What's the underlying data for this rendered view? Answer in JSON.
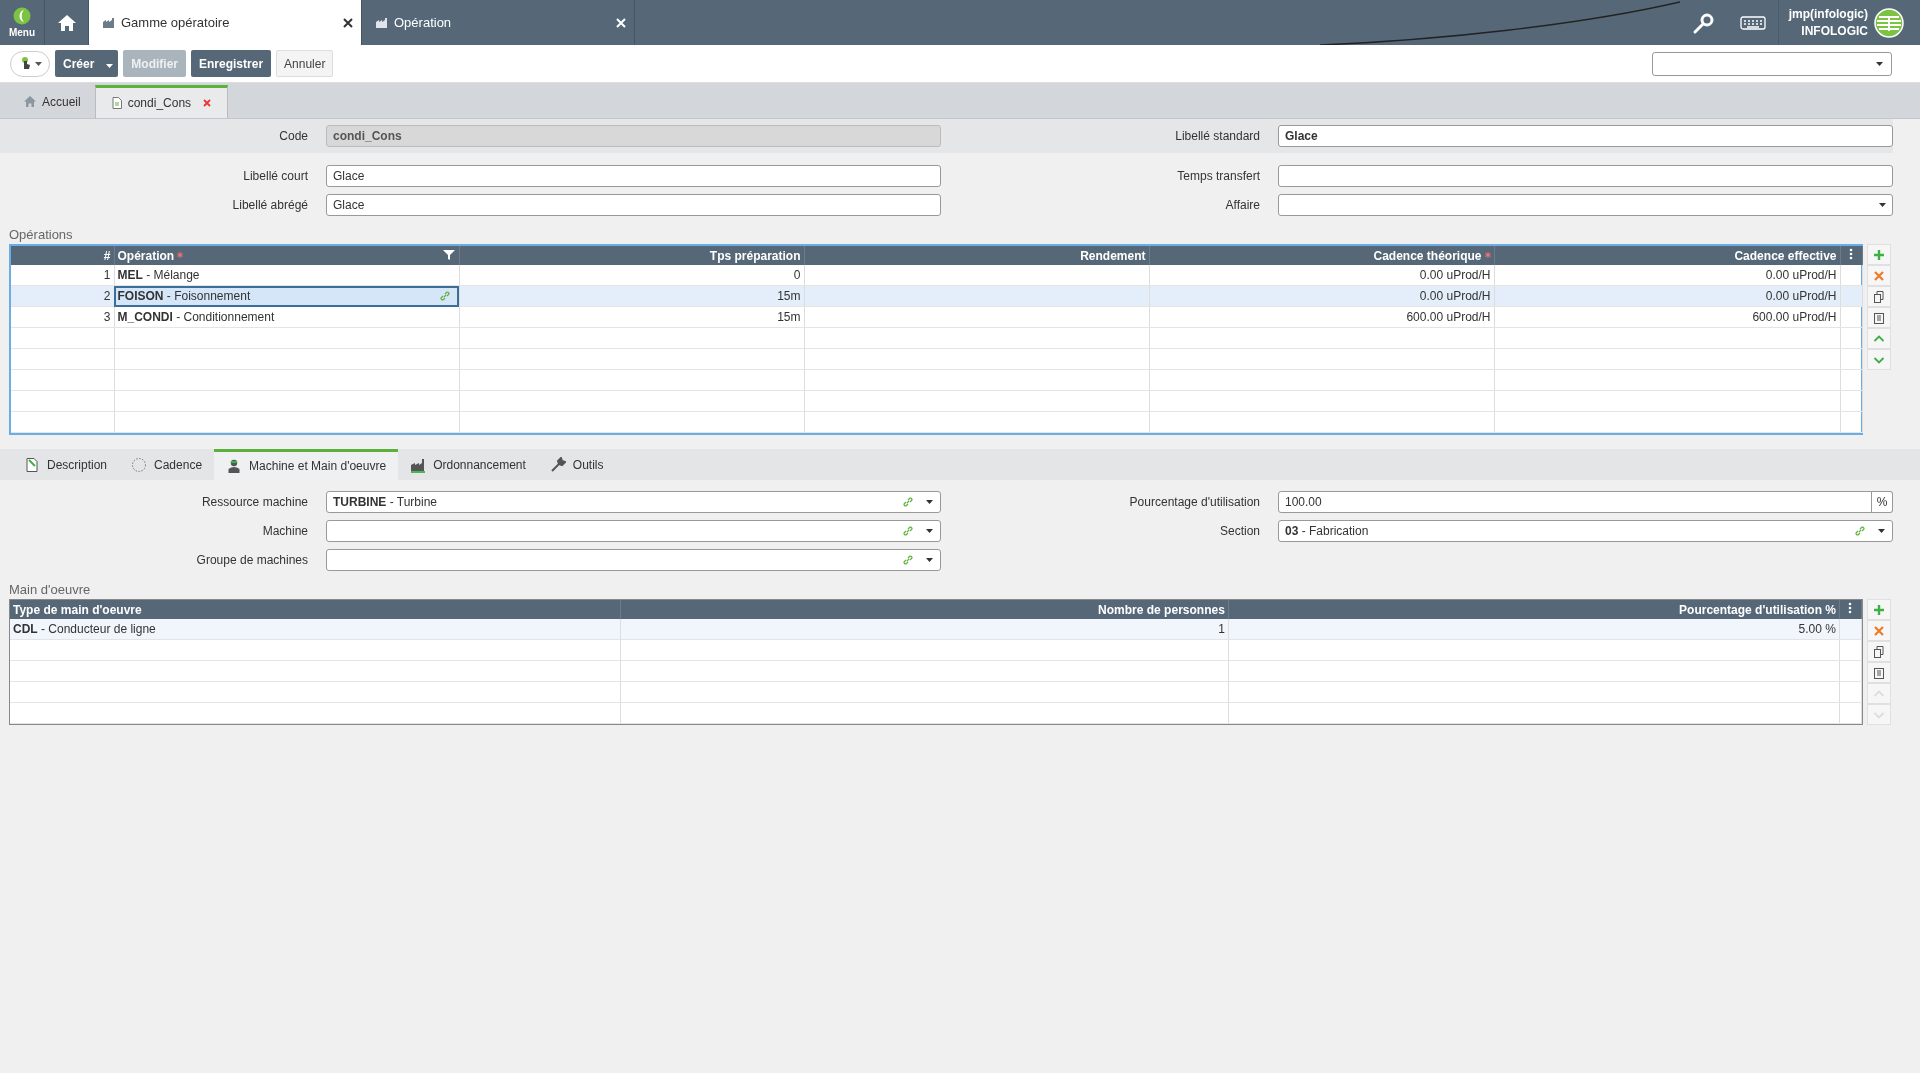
{
  "topbar": {
    "menu_label": "Menu",
    "tabs": [
      {
        "label": "Gamme opératoire",
        "selected": true
      },
      {
        "label": "Opération",
        "selected": false
      }
    ],
    "user": {
      "name": "jmp(infologic)",
      "company": "INFOLOGIC"
    }
  },
  "toolbar": {
    "buttons": [
      {
        "label": "Créer",
        "kind": "split"
      },
      {
        "label": "Modifier",
        "kind": "disabled"
      },
      {
        "label": "Enregistrer",
        "kind": "dark"
      },
      {
        "label": "Annuler",
        "kind": "light"
      }
    ]
  },
  "doc_tabs": [
    {
      "label": "Accueil",
      "selected": false,
      "kind": "home"
    },
    {
      "label": "condi_Cons",
      "selected": true,
      "kind": "doc"
    }
  ],
  "header_fields": [
    {
      "label": "Code",
      "value": "condi_Cons",
      "kind": "readonly"
    },
    {
      "label": "Libellé standard",
      "value": "Glace",
      "kind": "text",
      "bold": true
    },
    {
      "label": "Libellé court",
      "value": "Glace",
      "kind": "text",
      "bold": false
    },
    {
      "label": "Temps transfert",
      "kind": "text"
    },
    {
      "label": "Libellé abrégé",
      "value": "Glace",
      "kind": "text",
      "bold": false
    },
    {
      "label": "Affaire",
      "kind": "select"
    }
  ],
  "operations": {
    "title": "Opérations",
    "columns": [
      {
        "label": "#",
        "required": false,
        "filter": false,
        "kind": "number"
      },
      {
        "label": "Opération",
        "required": true,
        "filter": true,
        "kind": "text"
      },
      {
        "label": "Tps préparation",
        "required": false,
        "filter": false,
        "kind": "number"
      },
      {
        "label": "Rendement",
        "required": false,
        "filter": false,
        "kind": "number"
      },
      {
        "label": "Cadence théorique",
        "required": true,
        "filter": false,
        "kind": "number"
      },
      {
        "label": "Cadence effective",
        "required": false,
        "filter": false,
        "kind": "number"
      }
    ],
    "rows": [
      {
        "selected": false,
        "cells": [
          "1",
          "**MEL** - Mélange",
          "0",
          null,
          "0.00 uProd/H",
          "0.00 uProd/H"
        ]
      },
      {
        "selected": true,
        "cells": [
          "2",
          "**FOISON** - Foisonnement",
          "15m",
          null,
          "0.00 uProd/H",
          "0.00 uProd/H"
        ]
      },
      {
        "selected": false,
        "cells": [
          "3",
          "**M_CONDI** - Conditionnement",
          "15m",
          null,
          "600.00 uProd/H",
          "600.00 uProd/H"
        ]
      }
    ],
    "actions": [
      {
        "kind": "add",
        "disabled": false
      },
      {
        "kind": "delete",
        "disabled": false
      },
      {
        "kind": "copy",
        "disabled": false
      },
      {
        "kind": "paste",
        "disabled": false
      },
      {
        "kind": "up",
        "disabled": false
      },
      {
        "kind": "down",
        "disabled": false
      }
    ]
  },
  "sub_tabs": [
    {
      "label": "Description",
      "selected": false,
      "kind": "description"
    },
    {
      "label": "Cadence",
      "selected": false,
      "kind": "clock"
    },
    {
      "label": "Machine et Main d'oeuvre",
      "selected": true,
      "kind": "worker"
    },
    {
      "label": "Ordonnancement",
      "selected": false,
      "kind": "factory"
    },
    {
      "label": "Outils",
      "selected": false,
      "kind": "tool"
    }
  ],
  "machine_fields": [
    {
      "label": "Ressource machine",
      "value": "**TURBINE** - Turbine",
      "kind": "lookup"
    },
    {
      "label": "Pourcentage d'utilisation",
      "value": "100.00",
      "kind": "unit",
      "unit": "%"
    },
    {
      "label": "Machine",
      "kind": "lookup"
    },
    {
      "label": "Section",
      "value": "**03** - Fabrication",
      "kind": "lookup"
    },
    {
      "label": "Groupe de machines",
      "kind": "lookup"
    }
  ],
  "labour": {
    "title": "Main d'oeuvre",
    "columns": [
      {
        "label": "Type de main d'oeuvre",
        "required": false,
        "filter": false,
        "kind": "text"
      },
      {
        "label": "Nombre de personnes",
        "required": false,
        "filter": false,
        "kind": "number"
      },
      {
        "label": "Pourcentage d'utilisation %",
        "required": false,
        "filter": false,
        "kind": "number"
      }
    ],
    "rows": [
      {
        "selected": true,
        "cells": [
          "**CDL** - Conducteur de ligne",
          "1",
          "5.00 %"
        ]
      }
    ],
    "actions": [
      {
        "kind": "add",
        "disabled": false
      },
      {
        "kind": "delete",
        "disabled": false
      },
      {
        "kind": "copy",
        "disabled": false
      },
      {
        "kind": "paste",
        "disabled": false
      },
      {
        "kind": "up",
        "disabled": true
      },
      {
        "kind": "down",
        "disabled": true
      }
    ]
  }
}
